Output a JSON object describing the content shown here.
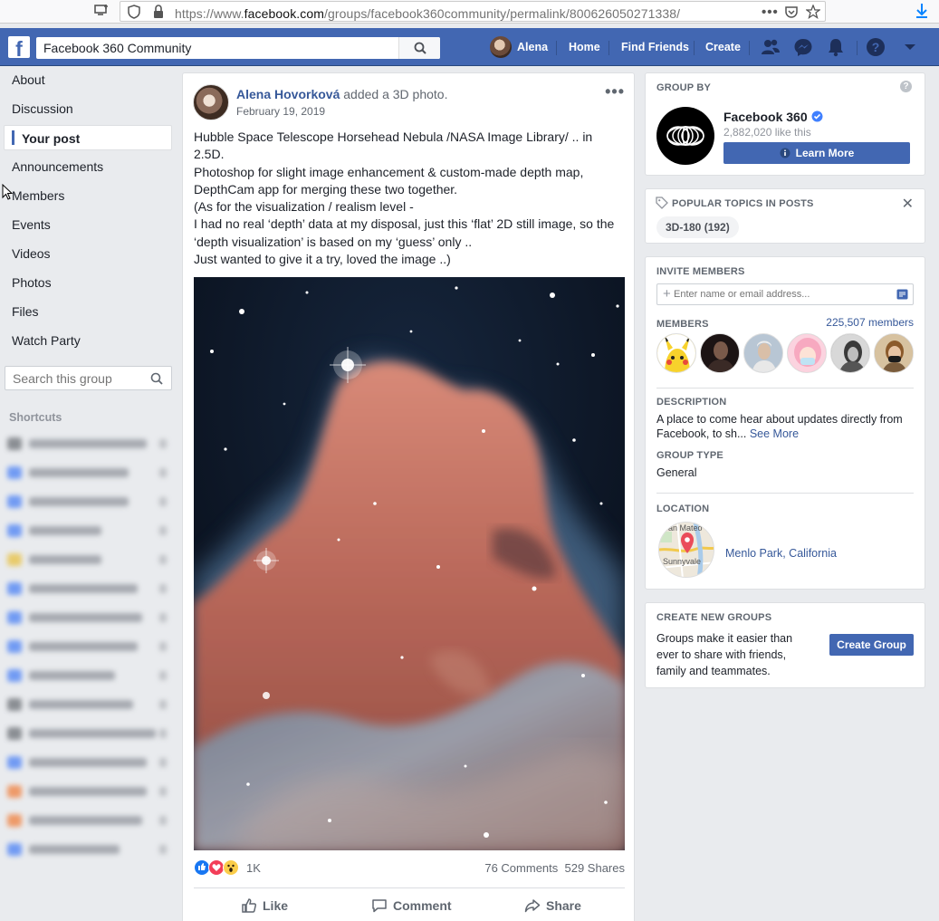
{
  "browser": {
    "url_prefix": "https://www.",
    "url_domain": "facebook.com",
    "url_path": "/groups/facebook360community/permalink/800626050271338/"
  },
  "header": {
    "search_value": "Facebook 360 Community",
    "user_name": "Alena",
    "nav": [
      "Home",
      "Find Friends",
      "Create"
    ],
    "brand_color": "#4267b2"
  },
  "left_nav": {
    "items": [
      "About",
      "Discussion",
      "Your post",
      "Announcements",
      "Members",
      "Events",
      "Videos",
      "Photos",
      "Files",
      "Watch Party"
    ],
    "active": "Your post",
    "search_placeholder": "Search this group",
    "shortcuts_title": "Shortcuts"
  },
  "post": {
    "author": "Alena Hovorková",
    "action": "added a 3D photo.",
    "date": "February 19, 2019",
    "text_lines": [
      "Hubble Space Telescope Horsehead Nebula /NASA Image Library/ .. in 2.5D.",
      "Photoshop for slight image enhancement & custom-made depth map, DepthCam app for merging these two together.",
      "(As for the visualization / realism level -",
      "I had no real ‘depth’ data at my disposal, just this ‘flat’ 2D still image, so the ‘depth visualization’ is based on my ‘guess’ only ..",
      "Just wanted to give it a try, loved the image ..)"
    ],
    "reaction_count": "1K",
    "comments": "76 Comments",
    "shares": "529 Shares",
    "actions": {
      "like": "Like",
      "comment": "Comment",
      "share": "Share"
    }
  },
  "group_by": {
    "title": "GROUP BY",
    "name": "Facebook 360",
    "likes": "2,882,020 like this",
    "learn_more": "Learn More"
  },
  "topics": {
    "title": "POPULAR TOPICS IN POSTS",
    "chip": "3D-180 (192)"
  },
  "invite": {
    "title": "INVITE MEMBERS",
    "placeholder": "Enter name or email address..."
  },
  "members": {
    "title": "MEMBERS",
    "count": "225,507 members"
  },
  "description": {
    "title": "DESCRIPTION",
    "text": "A place to come hear about updates directly from Facebook, to sh...",
    "see_more": "See More"
  },
  "group_type": {
    "title": "GROUP TYPE",
    "value": "General"
  },
  "location": {
    "title": "LOCATION",
    "value": "Menlo Park, California",
    "map_labels": [
      "San Mateo",
      "Sunnyvale"
    ]
  },
  "create_groups": {
    "title": "CREATE NEW GROUPS",
    "text": "Groups make it easier than ever to share with friends, family and teammates.",
    "button": "Create Group"
  }
}
